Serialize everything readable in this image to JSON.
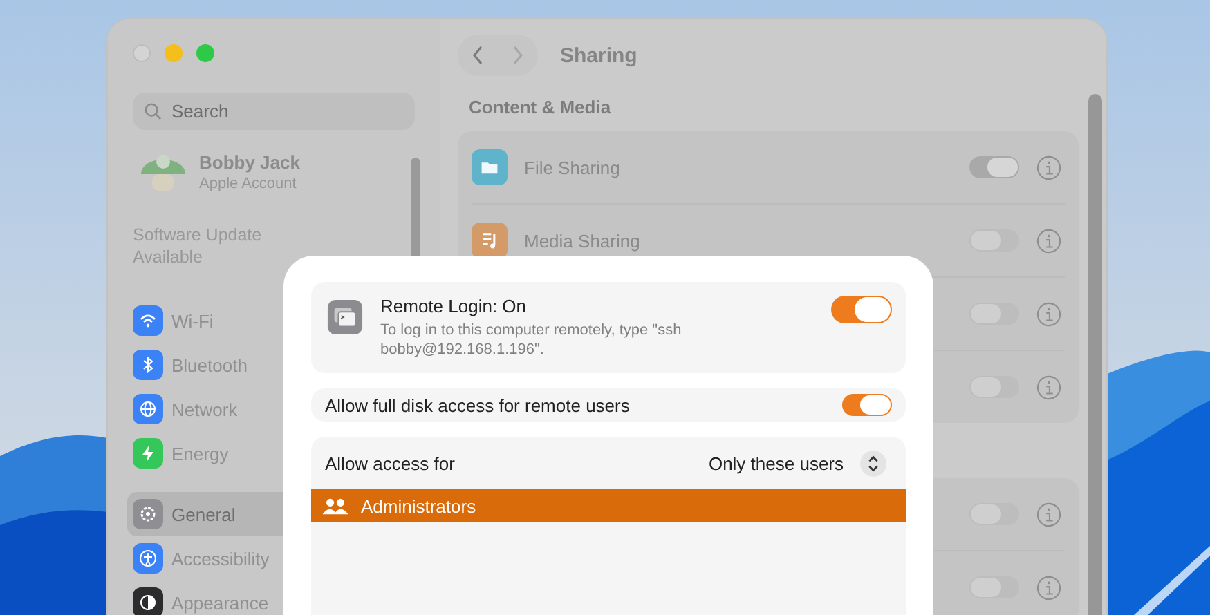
{
  "window": {
    "title": "Sharing",
    "traffic_lights": [
      {
        "kind": "close"
      },
      {
        "kind": "minimize"
      },
      {
        "kind": "zoom"
      }
    ]
  },
  "sidebar": {
    "search": {
      "placeholder": "Search"
    },
    "account": {
      "name": "Bobby Jack",
      "subtitle": "Apple Account"
    },
    "notice": "Software Update Available",
    "items": [
      {
        "label": "Wi-Fi",
        "color": "#3b82f6",
        "selected": false
      },
      {
        "label": "Bluetooth",
        "color": "#3b82f6",
        "selected": false
      },
      {
        "label": "Network",
        "color": "#3b82f6",
        "selected": false
      },
      {
        "label": "Energy",
        "color": "#34c759",
        "selected": false
      },
      {
        "label": "General",
        "color": "#8e8e93",
        "selected": true
      },
      {
        "label": "Accessibility",
        "color": "#3b82f6",
        "selected": false
      },
      {
        "label": "Appearance",
        "color": "#2c2c2e",
        "selected": false
      }
    ]
  },
  "content": {
    "section": "Content & Media",
    "groups": [
      [
        {
          "label": "File Sharing",
          "on": true
        },
        {
          "label": "Media Sharing",
          "on": false
        },
        {
          "on": false
        },
        {
          "on": false
        }
      ],
      [
        {
          "on": false
        },
        {
          "on": false
        }
      ]
    ]
  },
  "sheet": {
    "remote_login": {
      "title": "Remote Login: On",
      "description": "To log in to this computer remotely, type \"ssh bobby@192.168.1.196\".",
      "on": true
    },
    "full_disk": {
      "label": "Allow full disk access for remote users",
      "on": true
    },
    "access": {
      "label": "Allow access for",
      "value": "Only these users",
      "users": [
        {
          "name": "Administrators",
          "selected": true
        }
      ]
    }
  }
}
